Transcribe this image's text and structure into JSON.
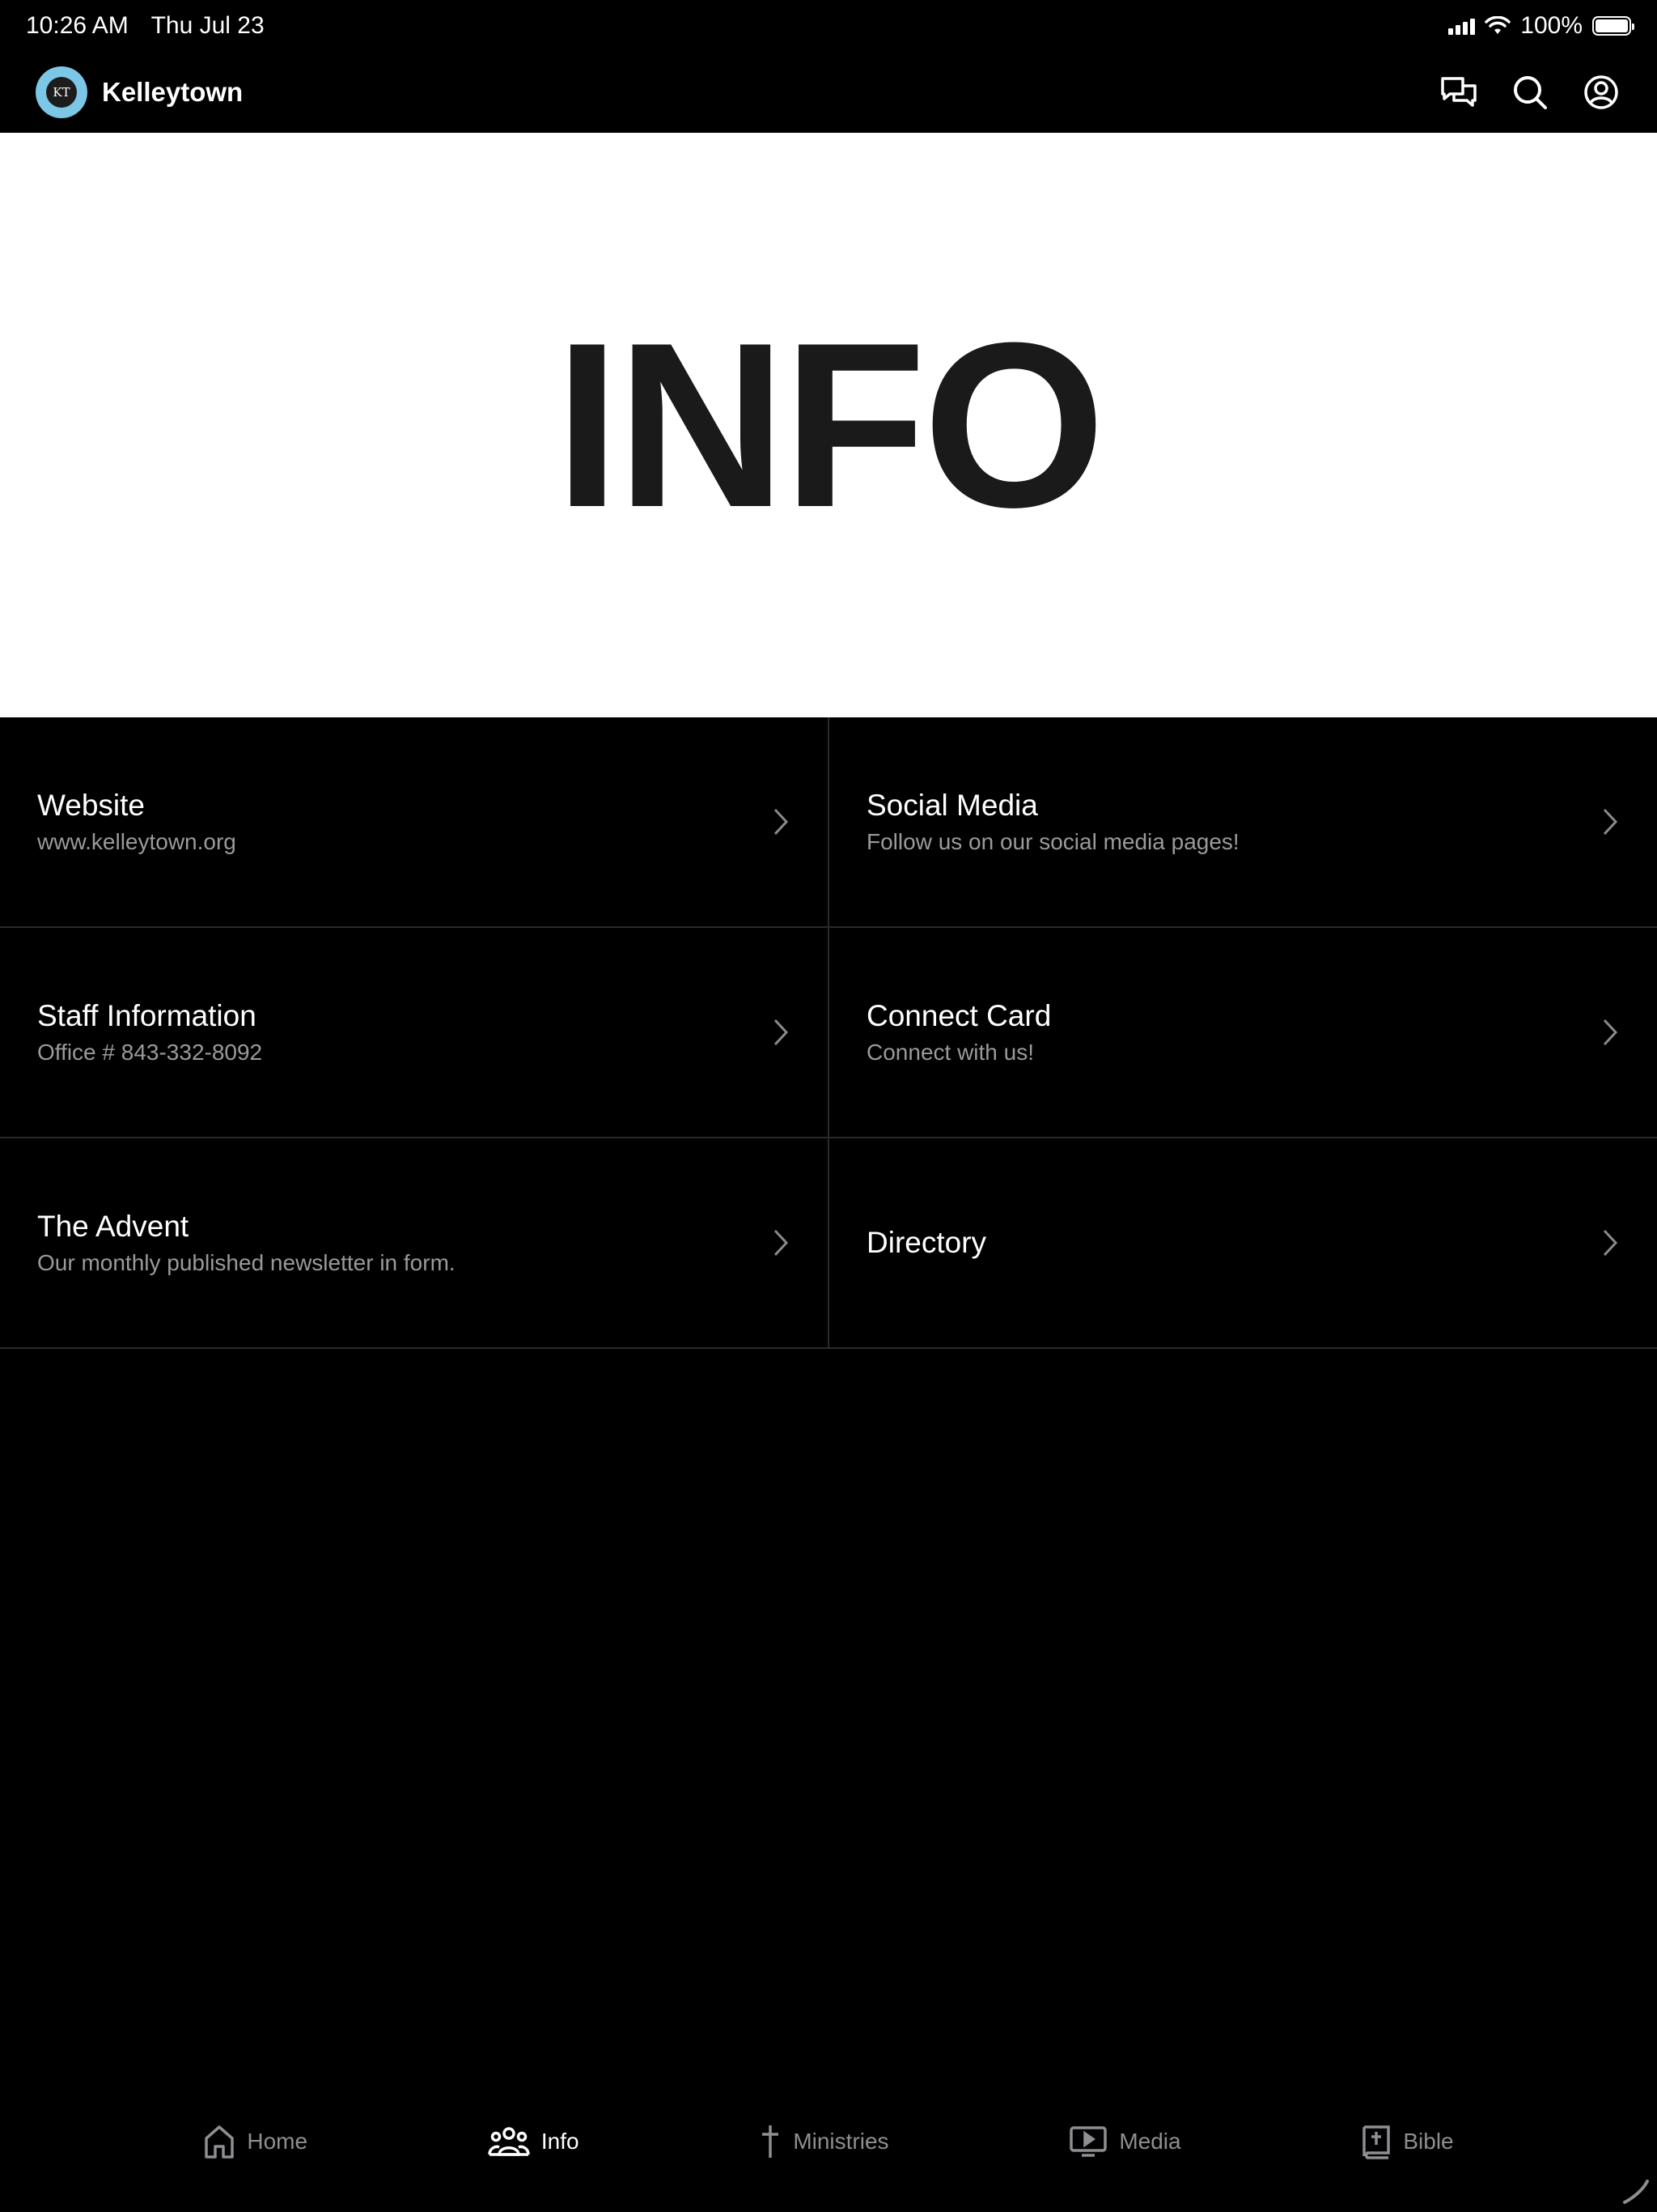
{
  "status_bar": {
    "time": "10:26 AM",
    "date": "Thu Jul 23",
    "battery": "100%"
  },
  "header": {
    "logo_text": "KT",
    "app_name": "Kelleytown",
    "actions": [
      "chat-icon",
      "search-icon",
      "profile-icon"
    ]
  },
  "hero": {
    "title": "INFO"
  },
  "items": [
    {
      "title": "Website",
      "subtitle": "www.kelleytown.org"
    },
    {
      "title": "Social Media",
      "subtitle": "Follow us on our social media pages!"
    },
    {
      "title": "Staff Information",
      "subtitle": "Office # 843-332-8092"
    },
    {
      "title": "Connect Card",
      "subtitle": "Connect with us!"
    },
    {
      "title": "The Advent",
      "subtitle": "Our monthly published newsletter in form."
    },
    {
      "title": "Directory",
      "subtitle": ""
    }
  ],
  "tabs": [
    {
      "label": "Home",
      "icon": "home-icon",
      "active": false
    },
    {
      "label": "Info",
      "icon": "people-icon",
      "active": true
    },
    {
      "label": "Ministries",
      "icon": "cross-icon",
      "active": false
    },
    {
      "label": "Media",
      "icon": "play-screen-icon",
      "active": false
    },
    {
      "label": "Bible",
      "icon": "bible-icon",
      "active": false
    }
  ],
  "colors": {
    "background": "#000000",
    "hero_background": "#ffffff",
    "hero_text": "#1b1a1b",
    "logo_accent": "#7cc6e6",
    "subtitle": "#9a9a9a",
    "inactive_tab": "#8e8e93"
  }
}
